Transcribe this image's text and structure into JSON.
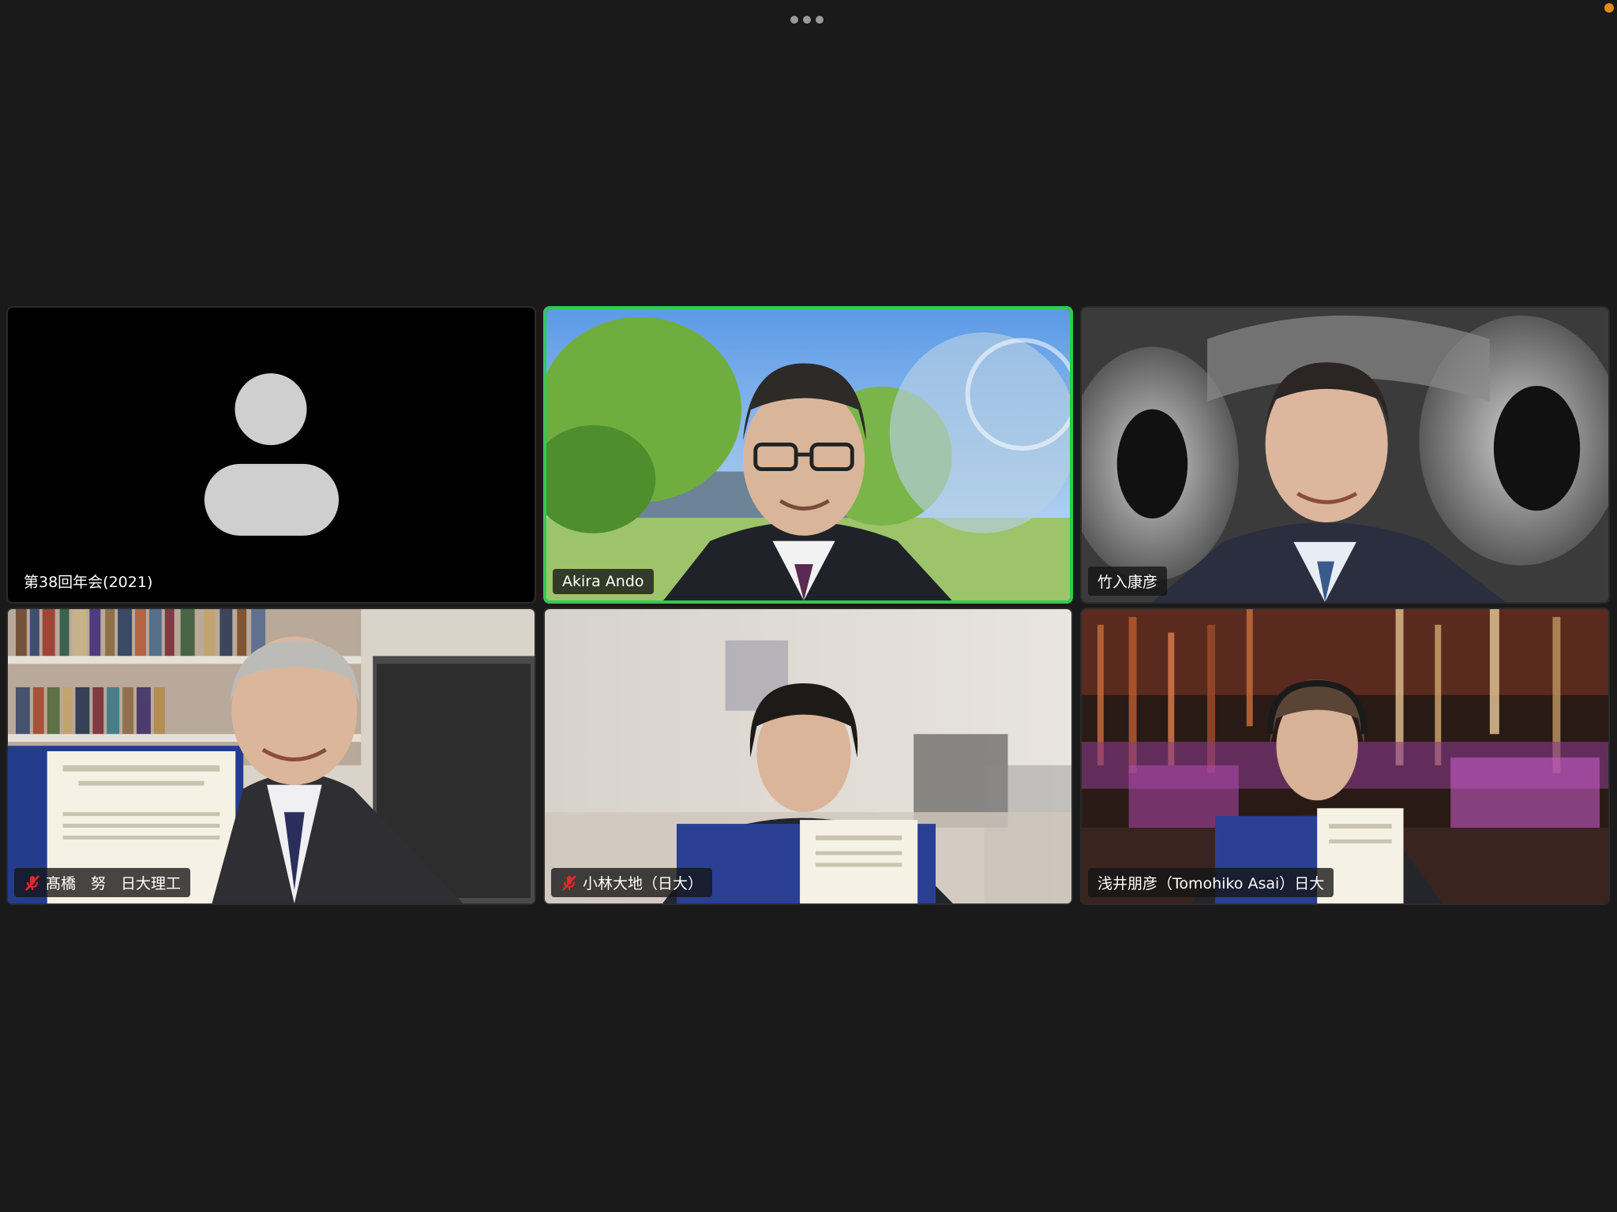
{
  "toolbar": {
    "more_icon": "more-horizontal-icon"
  },
  "status": {
    "recording_color": "#e58a12"
  },
  "active_speaker_color": "#2ecc52",
  "participants": [
    {
      "name": "第38回年会(2021)",
      "muted": false,
      "video": false,
      "icon": "avatar-placeholder-icon"
    },
    {
      "name": "Akira Ando",
      "muted": false,
      "video": true,
      "active_speaker": true
    },
    {
      "name": "竹入康彦",
      "muted": false,
      "video": true
    },
    {
      "name": "髙橋　努　日大理工",
      "muted": true,
      "video": true,
      "icon": "mic-muted-icon"
    },
    {
      "name": "小林大地（日大）",
      "muted": true,
      "video": true,
      "icon": "mic-muted-icon"
    },
    {
      "name": "浅井朋彦（Tomohiko Asai）日大",
      "muted": false,
      "video": true
    }
  ]
}
